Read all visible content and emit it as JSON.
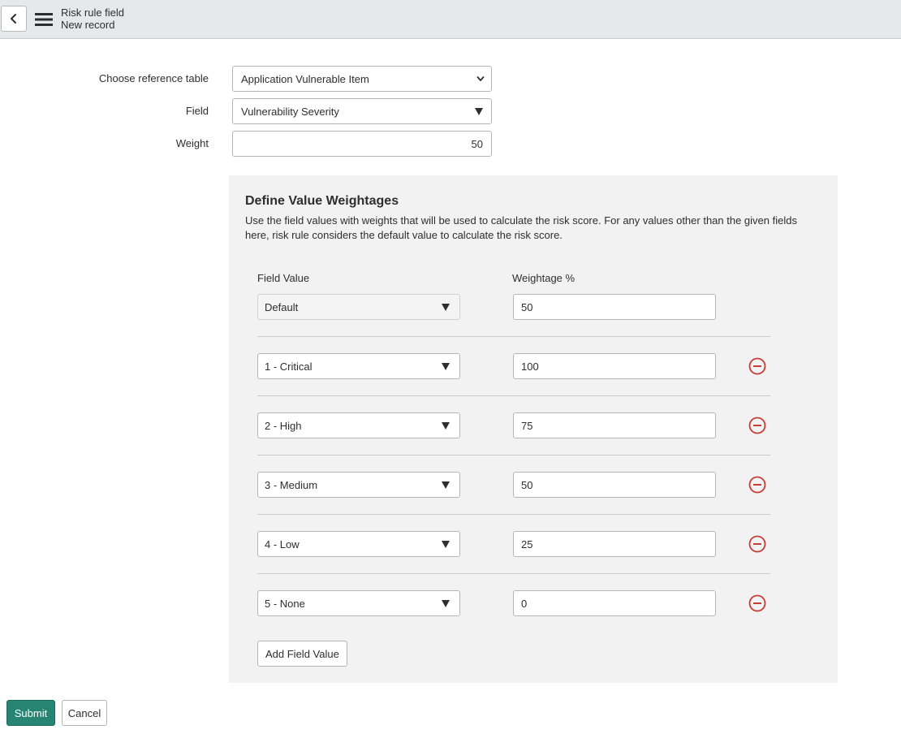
{
  "header": {
    "title": "Risk rule field",
    "subtitle": "New record",
    "back_icon": "chevron-left-icon",
    "menu_icon": "hamburger-menu-icon"
  },
  "form": {
    "reference_table": {
      "label": "Choose reference table",
      "value": "Application Vulnerable Item"
    },
    "field": {
      "label": "Field",
      "value": "Vulnerability Severity"
    },
    "weight": {
      "label": "Weight",
      "value": "50"
    }
  },
  "weightages": {
    "title": "Define Value Weightages",
    "description": "Use the field values with weights that will be used to calculate the risk score. For any values other than the given fields here, risk rule considers the default value to calculate the risk score.",
    "col_field_value": "Field Value",
    "col_weightage": "Weightage %",
    "rows": [
      {
        "field_value": "Default",
        "weightage": "50"
      },
      {
        "field_value": "1 - Critical",
        "weightage": "100"
      },
      {
        "field_value": "2 - High",
        "weightage": "75"
      },
      {
        "field_value": "3 - Medium",
        "weightage": "50"
      },
      {
        "field_value": "4 - Low",
        "weightage": "25"
      },
      {
        "field_value": "5 - None",
        "weightage": "0"
      }
    ],
    "remove_icon": "minus-circle-icon",
    "add_label": "Add Field Value"
  },
  "actions": {
    "submit_label": "Submit",
    "cancel_label": "Cancel"
  },
  "colors": {
    "header_bg": "#e6e8ea",
    "panel_bg": "#f2f2f2",
    "primary": "#278473",
    "danger": "#c83c36"
  }
}
